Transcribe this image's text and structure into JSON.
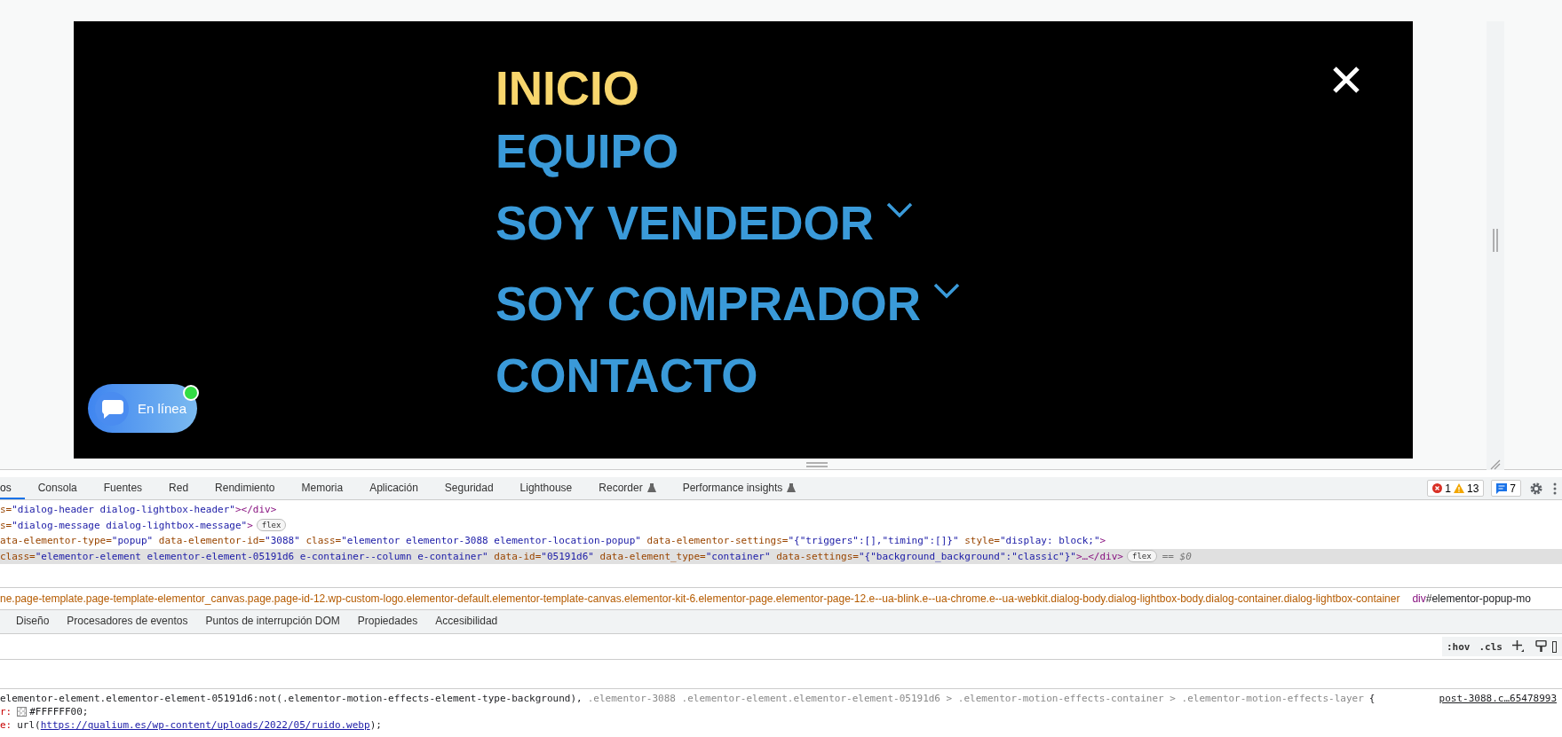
{
  "page": {
    "menu": [
      {
        "label": "INICIO",
        "selected": true,
        "kind": "link"
      },
      {
        "label": "EQUIPO",
        "selected": false,
        "kind": "link"
      },
      {
        "label": "SOY VENDEDOR",
        "selected": false,
        "kind": "dropdown"
      },
      {
        "label": "SOY COMPRADOR",
        "selected": false,
        "kind": "dropdown"
      },
      {
        "label": "CONTACTO",
        "selected": false,
        "kind": "link"
      }
    ],
    "chat_button": {
      "label": "En línea",
      "online": true
    }
  },
  "devtools": {
    "tabs": [
      {
        "label": "os",
        "selected": true,
        "experimental": false
      },
      {
        "label": "Consola",
        "selected": false,
        "experimental": false
      },
      {
        "label": "Fuentes",
        "selected": false,
        "experimental": false
      },
      {
        "label": "Red",
        "selected": false,
        "experimental": false
      },
      {
        "label": "Rendimiento",
        "selected": false,
        "experimental": false
      },
      {
        "label": "Memoria",
        "selected": false,
        "experimental": false
      },
      {
        "label": "Aplicación",
        "selected": false,
        "experimental": false
      },
      {
        "label": "Seguridad",
        "selected": false,
        "experimental": false
      },
      {
        "label": "Lighthouse",
        "selected": false,
        "experimental": false
      },
      {
        "label": "Recorder",
        "selected": false,
        "experimental": true
      },
      {
        "label": "Performance insights",
        "selected": false,
        "experimental": true
      }
    ],
    "issue_counts": {
      "errors": "1",
      "warnings": "13",
      "messages": "7"
    },
    "dom_lines": [
      {
        "selected": false,
        "tokens": [
          {
            "kind": "attr",
            "text": "s="
          },
          {
            "kind": "value",
            "text": "\"dialog-header dialog-lightbox-header\""
          },
          {
            "kind": "tag",
            "text": "></div>"
          }
        ]
      },
      {
        "selected": false,
        "tokens": [
          {
            "kind": "attr",
            "text": "s="
          },
          {
            "kind": "value",
            "text": "\"dialog-message dialog-lightbox-message\""
          },
          {
            "kind": "tag",
            "text": ">"
          },
          {
            "kind": "badge",
            "text": "flex"
          }
        ]
      },
      {
        "selected": false,
        "tokens": [
          {
            "kind": "attr",
            "text": "ata-elementor-type="
          },
          {
            "kind": "value",
            "text": "\"popup\""
          },
          {
            "kind": "attr",
            "text": " data-elementor-id="
          },
          {
            "kind": "value",
            "text": "\"3088\""
          },
          {
            "kind": "attr",
            "text": " class="
          },
          {
            "kind": "value",
            "text": "\"elementor elementor-3088 elementor-location-popup\""
          },
          {
            "kind": "attr",
            "text": " data-elementor-settings="
          },
          {
            "kind": "value",
            "text": "\"{\"triggers\":[],\"timing\":[]}\""
          },
          {
            "kind": "attr",
            "text": " style="
          },
          {
            "kind": "value",
            "text": "\"display: block;\""
          },
          {
            "kind": "tag",
            "text": ">"
          }
        ]
      },
      {
        "selected": true,
        "tokens": [
          {
            "kind": "attr",
            "text": "class="
          },
          {
            "kind": "value",
            "text": "\"elementor-element elementor-element-05191d6 e-container--column e-container\""
          },
          {
            "kind": "attr",
            "text": " data-id="
          },
          {
            "kind": "value",
            "text": "\"05191d6\""
          },
          {
            "kind": "attr",
            "text": " data-element_type="
          },
          {
            "kind": "value",
            "text": "\"container\""
          },
          {
            "kind": "attr",
            "text": " data-settings="
          },
          {
            "kind": "value",
            "text": "\"{\"background_background\":\"classic\"}\""
          },
          {
            "kind": "tag",
            "text": ">…</div>"
          },
          {
            "kind": "badge",
            "text": "flex"
          },
          {
            "kind": "plain",
            "text": "== $0"
          }
        ]
      }
    ],
    "breadcrumb": [
      {
        "kind": "classes",
        "text": "ne.page-template.page-template-elementor_canvas.page.page-id-12.wp-custom-logo.elementor-default.elementor-template-canvas.elementor-kit-6.elementor-page.elementor-page-12.e--ua-blink.e--ua-chrome.e--ua-webkit.dialog-body.dialog-lightbox-body.dialog-container.dialog-lightbox-container"
      },
      {
        "kind": "element",
        "tag": "div",
        "text": "#elementor-popup-mo"
      }
    ],
    "panel_tabs": [
      {
        "label": "Diseño",
        "selected": false
      },
      {
        "label": "Procesadores de eventos",
        "selected": false
      },
      {
        "label": "Puntos de interrupción DOM",
        "selected": false
      },
      {
        "label": "Propiedades",
        "selected": false
      },
      {
        "label": "Accesibilidad",
        "selected": false
      }
    ],
    "filter_buttons": [
      ":hov",
      ".cls"
    ],
    "style_rule": {
      "selector": [
        {
          "text": "elementor-element.elementor-element-05191d6:not(.elementor-motion-effects-element-type-background),",
          "matched": true
        },
        {
          "text": ".elementor-3088 .elementor-element.elementor-element-05191d6 > .elementor-motion-effects-container > .elementor-motion-effects-layer",
          "matched": false
        },
        {
          "text": "{",
          "matched": true
        }
      ],
      "source": "post-3088.c…65478993",
      "declarations": [
        {
          "property": "r:",
          "swatch": true,
          "value": "#FFFFFF00;"
        },
        {
          "property": "e:",
          "swatch": false,
          "value": "url(",
          "link": "https://qualium.es/wp-content/uploads/2022/05/ruido.webp",
          "after": ");"
        }
      ]
    }
  }
}
